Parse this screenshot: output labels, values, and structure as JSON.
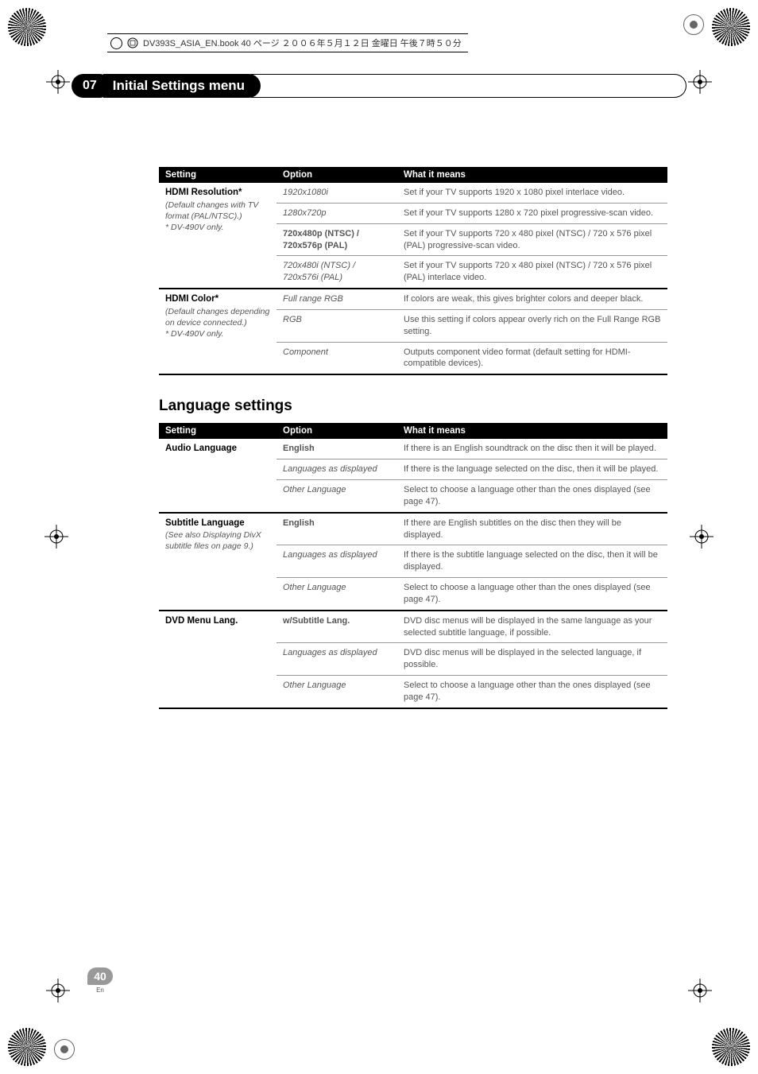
{
  "print_header": "DV393S_ASIA_EN.book 40 ページ ２００６年５月１２日 金曜日 午後７時５０分",
  "chapter": {
    "number": "07",
    "title": "Initial Settings menu"
  },
  "table1": {
    "headers": [
      "Setting",
      "Option",
      "What it means"
    ],
    "groups": [
      {
        "label": "HDMI Resolution*",
        "note": "(Default changes with TV format (PAL/NTSC).)\n* DV-490V only.",
        "rows": [
          {
            "opt": "1920x1080i",
            "opt_style": "italic",
            "desc": "Set if your TV supports 1920 x 1080 pixel interlace video."
          },
          {
            "opt": "1280x720p",
            "opt_style": "italic",
            "desc": "Set if your TV supports 1280 x 720 pixel progressive-scan video."
          },
          {
            "opt": "720x480p (NTSC) / 720x576p (PAL)",
            "opt_style": "bold",
            "desc": "Set if your TV supports 720 x 480 pixel (NTSC) / 720 x 576 pixel (PAL) progressive-scan video."
          },
          {
            "opt": "720x480i (NTSC) / 720x576i (PAL)",
            "opt_style": "italic",
            "desc": "Set if your TV supports 720 x 480 pixel (NTSC) / 720 x 576 pixel (PAL) interlace video."
          }
        ]
      },
      {
        "label": "HDMI Color*",
        "note": "(Default changes depending on device connected.)\n* DV-490V only.",
        "rows": [
          {
            "opt": "Full range RGB",
            "opt_style": "italic",
            "desc": "If colors are weak, this gives brighter colors and deeper black."
          },
          {
            "opt": "RGB",
            "opt_style": "italic",
            "desc": "Use this setting if colors appear overly rich on the Full Range RGB setting."
          },
          {
            "opt": "Component",
            "opt_style": "italic",
            "desc": "Outputs component video format (default setting for HDMI-compatible devices)."
          }
        ]
      }
    ]
  },
  "section_heading": "Language settings",
  "table2": {
    "headers": [
      "Setting",
      "Option",
      "What it means"
    ],
    "groups": [
      {
        "label": "Audio Language",
        "note": "",
        "rows": [
          {
            "opt": "English",
            "opt_style": "bold",
            "desc": "If there is an English soundtrack on the disc then it will be played."
          },
          {
            "opt": "Languages as displayed",
            "opt_style": "italic",
            "desc": "If there is the language selected on the disc, then it will be played."
          },
          {
            "opt": "Other Language",
            "opt_style": "italic",
            "desc": "Select to choose a language other than the ones displayed (see page 47)."
          }
        ]
      },
      {
        "label": "Subtitle Language",
        "note": "(See also Displaying DivX subtitle files on page 9.)",
        "rows": [
          {
            "opt": "English",
            "opt_style": "bold",
            "desc": "If there are English subtitles on the disc then they will be displayed."
          },
          {
            "opt": "Languages as displayed",
            "opt_style": "italic",
            "desc": "If there is the subtitle language selected on the disc, then it will be displayed."
          },
          {
            "opt": "Other Language",
            "opt_style": "italic",
            "desc": "Select to choose a language other than the ones displayed (see page 47)."
          }
        ]
      },
      {
        "label": "DVD Menu Lang.",
        "note": "",
        "rows": [
          {
            "opt": "w/Subtitle Lang.",
            "opt_style": "bold",
            "desc": "DVD disc menus will be displayed in the same language as your selected subtitle language, if possible."
          },
          {
            "opt": "Languages as displayed",
            "opt_style": "italic",
            "desc": "DVD disc menus will be displayed in the selected language, if possible."
          },
          {
            "opt": "Other Language",
            "opt_style": "italic",
            "desc": "Select to choose a language other than the ones displayed (see page 47)."
          }
        ]
      }
    ]
  },
  "page": {
    "number": "40",
    "lang": "En"
  }
}
